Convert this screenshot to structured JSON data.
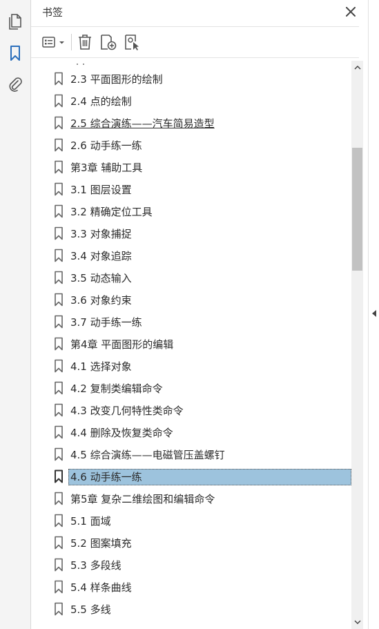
{
  "panel": {
    "title": "书签"
  },
  "colors": {
    "accent": "#2a6ebb",
    "selection": "#9dc3dd",
    "icon": "#555555"
  },
  "leftnav": {
    "items": [
      {
        "name": "pages-icon"
      },
      {
        "name": "bookmark-icon"
      },
      {
        "name": "attachment-icon"
      }
    ]
  },
  "toolbar": {
    "buttons": [
      "options-menu-icon",
      "delete-icon",
      "new-bookmark-icon",
      "bookmark-from-selection-icon"
    ]
  },
  "bookmarks": [
    {
      "label": "2.3 平面图形的绘制"
    },
    {
      "label": "2.4 点的绘制"
    },
    {
      "label": "2.5 综合演练——汽车简易造型",
      "link": true
    },
    {
      "label": "2.6 动手练一练"
    },
    {
      "label": "第3章 辅助工具"
    },
    {
      "label": "3.1 图层设置"
    },
    {
      "label": "3.2 精确定位工具"
    },
    {
      "label": "3.3 对象捕捉"
    },
    {
      "label": "3.4 对象追踪"
    },
    {
      "label": "3.5 动态输入"
    },
    {
      "label": "3.6 对象约束"
    },
    {
      "label": "3.7 动手练一练"
    },
    {
      "label": "第4章 平面图形的编辑"
    },
    {
      "label": "4.1 选择对象"
    },
    {
      "label": "4.2 复制类编辑命令"
    },
    {
      "label": "4.3 改变几何特性类命令"
    },
    {
      "label": "4.4 删除及恢复类命令"
    },
    {
      "label": "4.5 综合演练——电磁管压盖螺钉"
    },
    {
      "label": "4.6 动手练一练",
      "selected": true
    },
    {
      "label": "第5章 复杂二维绘图和编辑命令"
    },
    {
      "label": "5.1 面域"
    },
    {
      "label": "5.2 图案填充"
    },
    {
      "label": "5.3 多段线"
    },
    {
      "label": "5.4 样条曲线"
    },
    {
      "label": "5.5 多线"
    }
  ]
}
